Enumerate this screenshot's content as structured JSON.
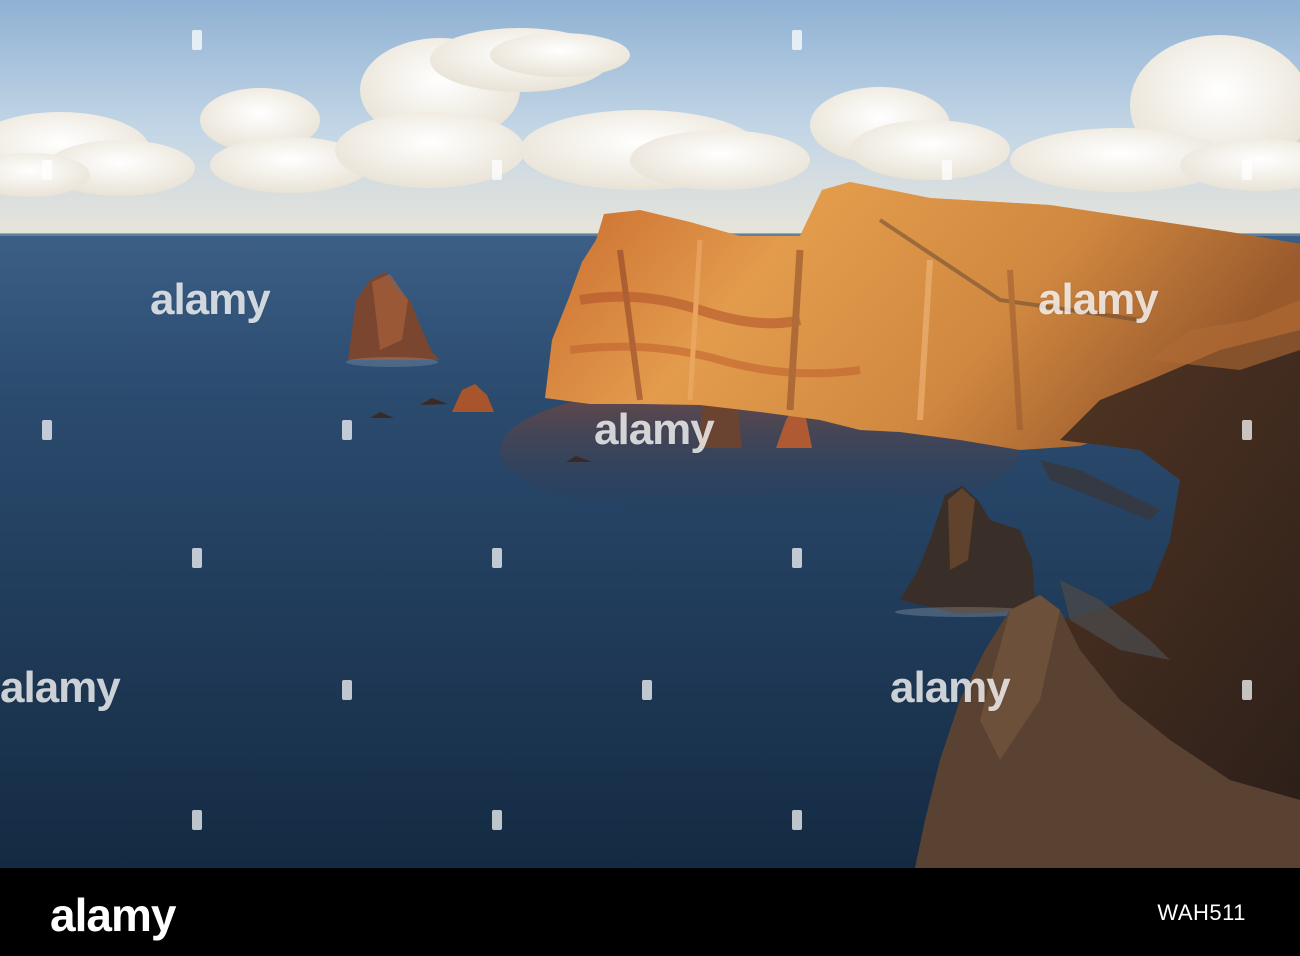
{
  "watermark": {
    "text": "alamy"
  },
  "footer": {
    "logo": "alamy",
    "image_id": "WAH511"
  },
  "colors": {
    "sky": "#b9cfe2",
    "sea": "#1e3650",
    "cliff_lit": "#d68a3c",
    "cliff_shadow": "#3a2a22",
    "footer": "#000000"
  }
}
